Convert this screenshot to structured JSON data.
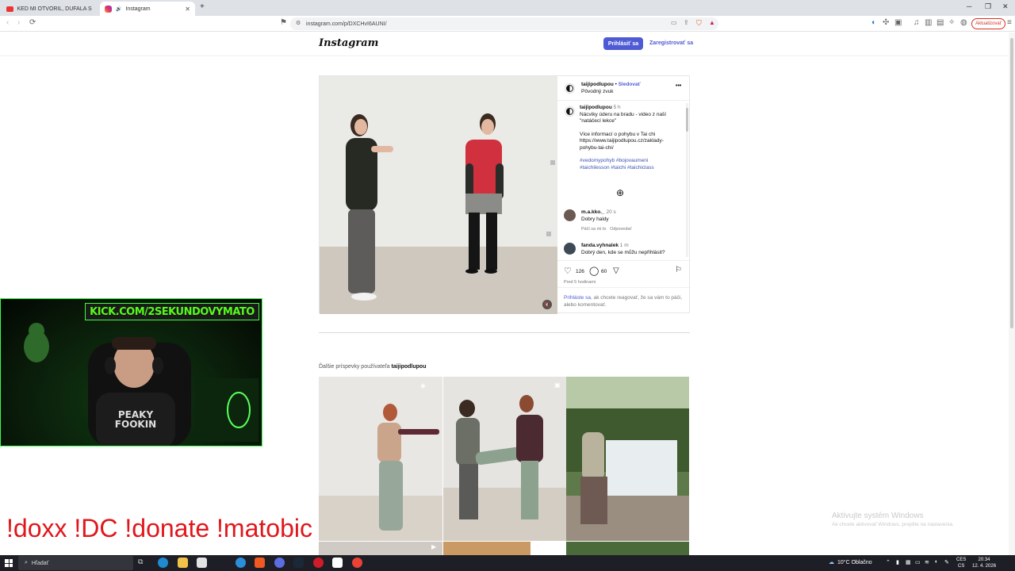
{
  "browser": {
    "tabs": [
      {
        "title": "KEĎ MI OTVORIL, DÚFALA SOM, ŽE...",
        "active": false,
        "favicon": "youtube-icon"
      },
      {
        "title": "Instagram",
        "active": true,
        "favicon": "instagram-icon"
      }
    ],
    "new_tab": "+",
    "url": "instagram.com/p/DXCHvI6AUNI/",
    "update_button": "Aktualizovať",
    "window_controls": {
      "minimize": "─",
      "maximize": "❐",
      "close": "✕"
    }
  },
  "instagram": {
    "logo": "Instagram",
    "login_button": "Prihlásiť sa",
    "register_link": "Zaregistrovať sa",
    "post": {
      "author": "taijipodlupou",
      "follow_separator": "•",
      "follow": "Sledovať",
      "audio": "Pôvodný zvuk",
      "more": "•••",
      "caption": {
        "author": "taijipodlupou",
        "time": "5 h",
        "lines": [
          "Nácviky úderu na bradu - video z naší",
          "\"natáčecí lekce\""
        ],
        "more_lines": [
          "Více informací o pohybu v Tai chi",
          "https://www.taijipodlupou.cz/zaklady-",
          "pohybu-tai-chi/"
        ],
        "hashtags": [
          "#vedomypohyb #bojovaumeni",
          "#taichilesson #taichi #taichiclass"
        ]
      },
      "load_more": "⊕",
      "comments": [
        {
          "user": "m.a.kko._",
          "time": "20 s",
          "text": "Dobry haldy",
          "like": "Páči sa mi to",
          "reply": "Odpovedať"
        },
        {
          "user": "fanda.vyhnalek",
          "time": "1 m",
          "text": "Dobrý den, kde se můžu nepřihlásit?"
        }
      ],
      "likes": "126",
      "comment_count": "60",
      "posted": "Pred 5 hodinami",
      "login_link": "Prihláste sa",
      "login_prompt": ", ak chcete reagovať, že sa vám to páči, alebo komentovať."
    },
    "more_posts_prefix": "Ďalšie príspevky používateľa ",
    "more_posts_user": "taijipodlupou"
  },
  "stream": {
    "banner": "KICK.COM/2SEKUNDOVYMATO",
    "shirt_text": [
      "PEAKY",
      "FOOKIN"
    ],
    "commands": "!doxx  !DC !donate !matobic"
  },
  "windows": {
    "activate_title": "Aktivujte systém Windows",
    "activate_sub": "Ak chcete aktivovať Windows, prejdite na nastavenia.",
    "search_placeholder": "Hľadať",
    "weather": "10°C  Oblačno",
    "lang_top": "CES",
    "lang_bottom": "CS",
    "time": "20:34",
    "date": "12. 4. 2026"
  },
  "colors": {
    "accent": "#4f5bd5",
    "kick_green": "#53fc18",
    "overlay_red": "#e1161b"
  }
}
